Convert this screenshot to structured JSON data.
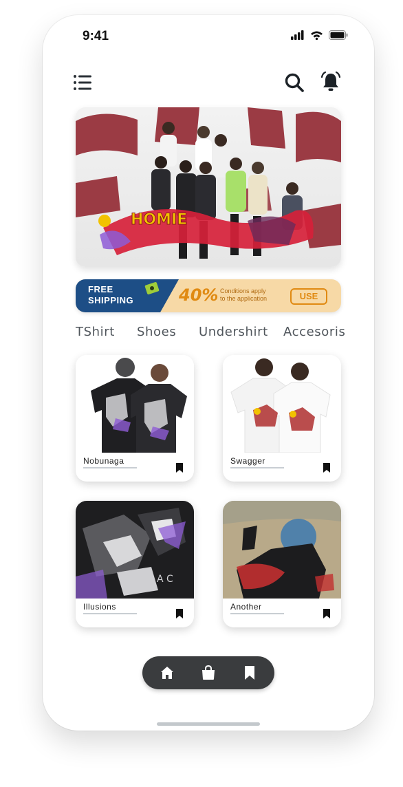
{
  "status_bar": {
    "time": "9:41",
    "icons": [
      "signal-icon",
      "wifi-icon",
      "battery-icon"
    ]
  },
  "header": {
    "icons": [
      "menu-icon",
      "search-icon",
      "bell-icon"
    ]
  },
  "hero": {
    "graffiti_text": "HOMIE",
    "colors": {
      "brand_red": "#9b3b44",
      "graffiti_red": "#d6213a",
      "graffiti_yellow": "#f2c200"
    }
  },
  "promo": {
    "free_line1": "FREE",
    "free_line2": "SHIPPING",
    "percent": "40%",
    "condition_line1": "Conditions apply",
    "condition_line2": "to the application",
    "use_label": "USE",
    "colors": {
      "navy": "#1d4e86",
      "amber": "#e08a12",
      "cream": "#f7d9a6"
    }
  },
  "categories": [
    "TShirt",
    "Shoes",
    "Undershirt",
    "Accesoris"
  ],
  "products": [
    {
      "name": "Nobunaga"
    },
    {
      "name": "Swagger"
    },
    {
      "name": "Illusions"
    },
    {
      "name": "Another"
    }
  ],
  "bottom_nav": {
    "icons": [
      "home-icon",
      "bag-icon",
      "bookmark-icon"
    ],
    "color": "#3a3c3e"
  }
}
